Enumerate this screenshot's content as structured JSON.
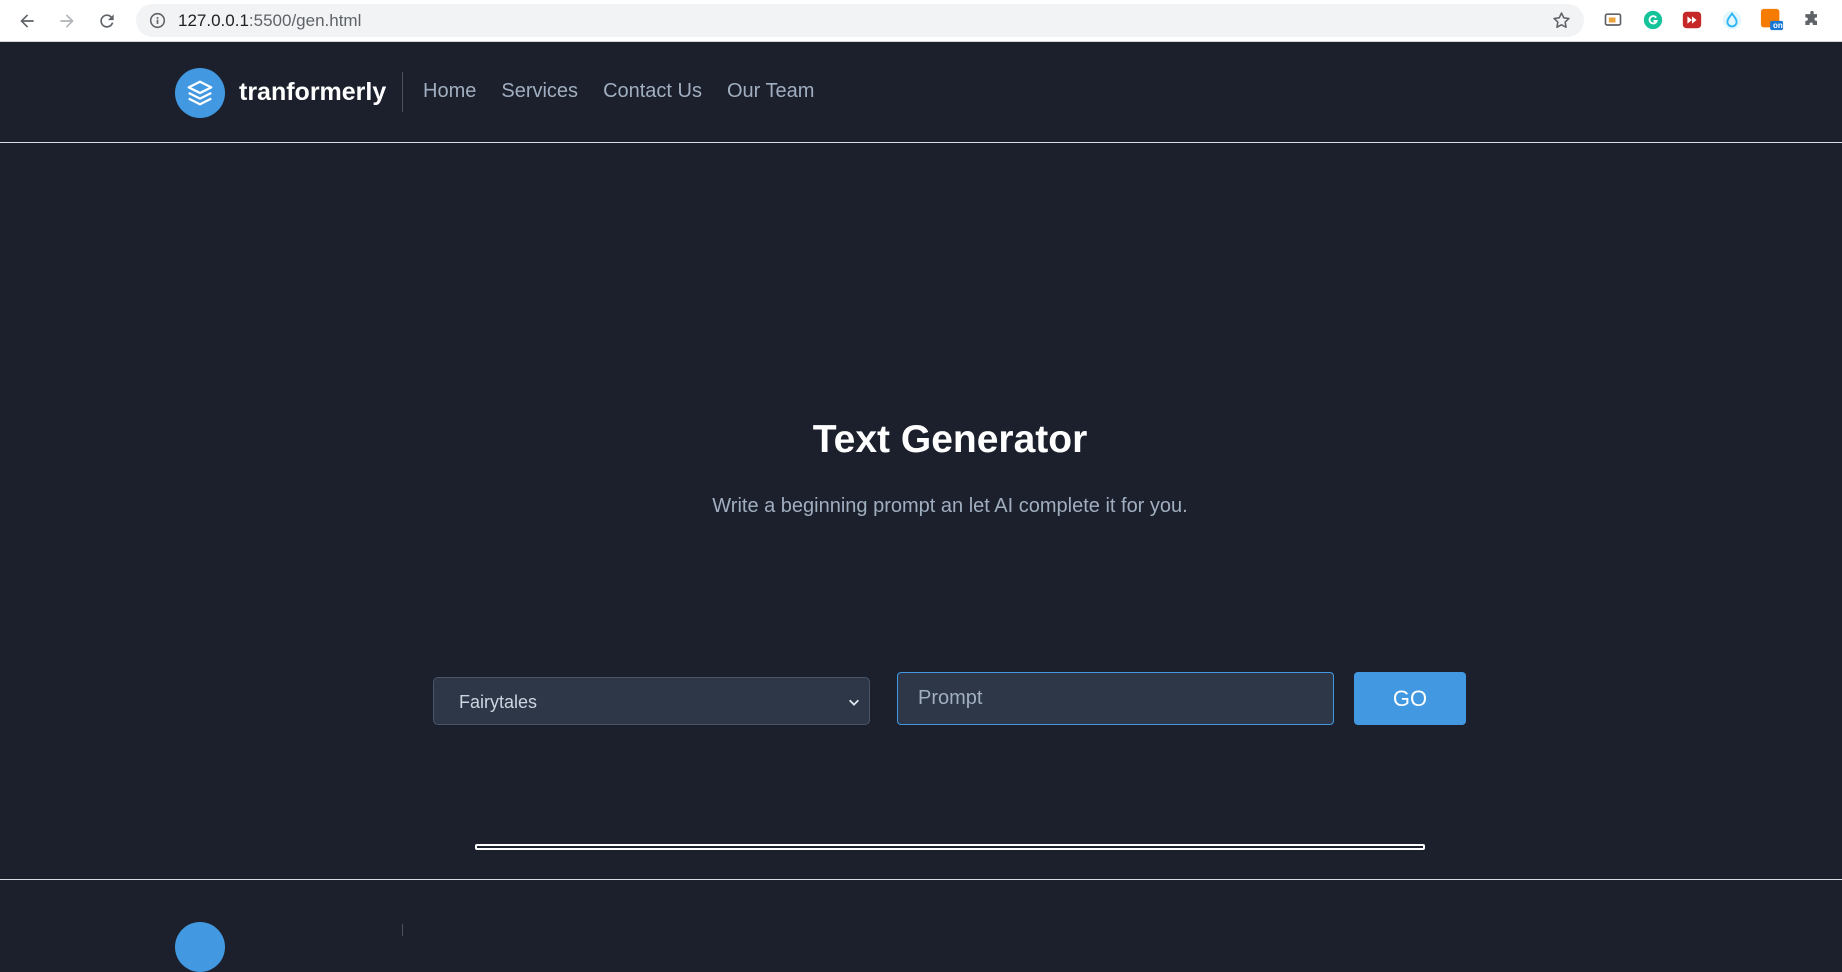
{
  "browser": {
    "url_host": "127.0.0.1",
    "url_rest": ":5500/gen.html",
    "extension_badge": "on"
  },
  "header": {
    "brand": "tranformerly",
    "nav": [
      {
        "label": "Home"
      },
      {
        "label": "Services"
      },
      {
        "label": "Contact Us"
      },
      {
        "label": "Our Team"
      }
    ]
  },
  "hero": {
    "title": "Text Generator",
    "subtitle": "Write a beginning prompt an let AI complete it for you."
  },
  "form": {
    "category_selected": "Fairytales",
    "prompt_placeholder": "Prompt",
    "prompt_value": "",
    "go_label": "GO"
  },
  "colors": {
    "background": "#1b202c",
    "accent": "#4299e1",
    "muted_text": "#a0aec0",
    "field_bg": "#2d3748"
  }
}
